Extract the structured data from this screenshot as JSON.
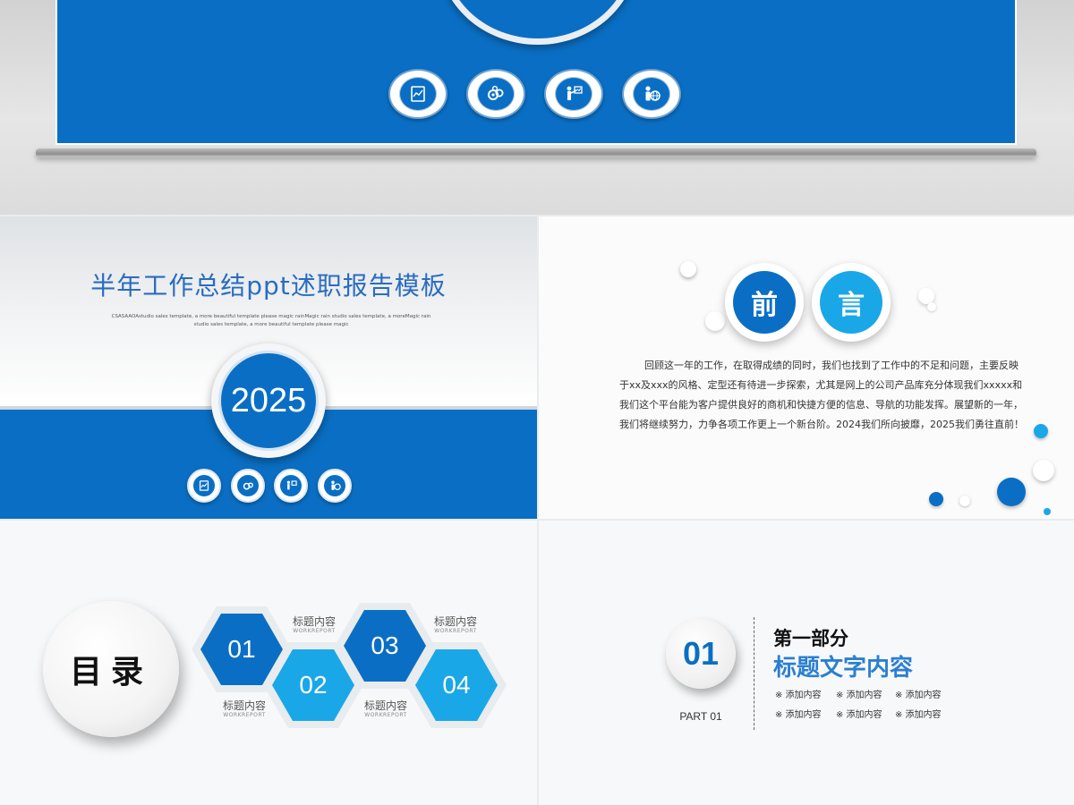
{
  "colors": {
    "primary_blue": "#0a6fc4",
    "light_blue": "#1aa7e8",
    "accent_blue": "#2a7fd0"
  },
  "banner": {
    "icons": [
      "chart-document-icon",
      "gears-icon",
      "presenter-icon",
      "user-globe-icon"
    ]
  },
  "title_slide": {
    "title": "半年工作总结ppt述职报告模板",
    "subtitle": "CSASAAOAstudio sales template, a more beautiful template please magic rainMagic rain studio sales template, a moreMagic rain studio sales template, a more beautiful template please magic",
    "year": "2025",
    "icons": [
      "chart-document-icon",
      "gears-icon",
      "presenter-icon",
      "user-globe-icon"
    ]
  },
  "preface": {
    "heading_chars": [
      "前",
      "言"
    ],
    "body": "回顾这一年的工作，在取得成绩的同时，我们也找到了工作中的不足和问题，主要反映于xx及xxx的风格、定型还有待进一步探索，尤其是网上的公司产品库充分体现我们xxxxx和我们这个平台能为客户提供良好的商机和快捷方便的信息、导航的功能发挥。展望新的一年，我们将继续努力，力争各项工作更上一个新台阶。2024我们所向披靡，2025我们勇往直前！"
  },
  "contents": {
    "heading": "目录",
    "items": [
      {
        "number": "01",
        "label": "标题内容",
        "sub": "WORKREPORT"
      },
      {
        "number": "02",
        "label": "标题内容",
        "sub": "WORKREPORT"
      },
      {
        "number": "03",
        "label": "标题内容",
        "sub": "WORKREPORT"
      },
      {
        "number": "04",
        "label": "标题内容",
        "sub": "WORKREPORT"
      }
    ]
  },
  "part": {
    "number": "01",
    "label": "PART 01",
    "title": "第一部分",
    "subtitle": "标题文字内容",
    "items": [
      "※ 添加内容",
      "※ 添加内容",
      "※ 添加内容",
      "※ 添加内容",
      "※ 添加内容",
      "※ 添加内容"
    ]
  }
}
